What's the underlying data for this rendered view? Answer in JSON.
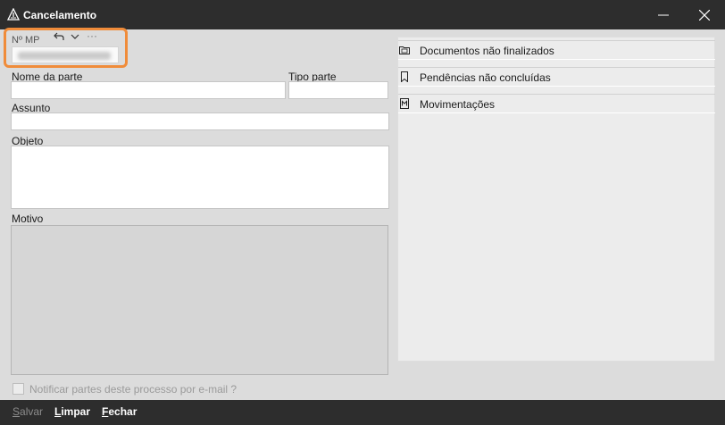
{
  "window": {
    "title": "Cancelamento",
    "icon": "warning-triangle-icon"
  },
  "mp": {
    "label": "Nº MP",
    "value": "(redacted)",
    "more": "···"
  },
  "fields": {
    "nome_parte": "Nome da parte",
    "tipo_parte": "Tipo parte",
    "assunto": "Assunto",
    "objeto": "Objeto",
    "motivo": "Motivo"
  },
  "notify": {
    "label": "Notificar partes deste processo por e-mail ?",
    "checked": false
  },
  "right_panel": {
    "items": [
      {
        "label": "Documentos não finalizados",
        "icon": "folder-doc-icon"
      },
      {
        "label": "Pendências não concluídas",
        "icon": "bookmark-icon"
      },
      {
        "label": "Movimentações",
        "icon": "document-m-icon"
      }
    ]
  },
  "footer": {
    "salvar": {
      "first": "S",
      "rest": "alvar"
    },
    "limpar": {
      "first": "L",
      "rest": "impar"
    },
    "fechar": {
      "first": "F",
      "rest": "echar"
    }
  },
  "colors": {
    "titlebar_bg": "#2d2d2d",
    "highlight": "#f08c3a",
    "body_bg": "#dcdcdc"
  }
}
